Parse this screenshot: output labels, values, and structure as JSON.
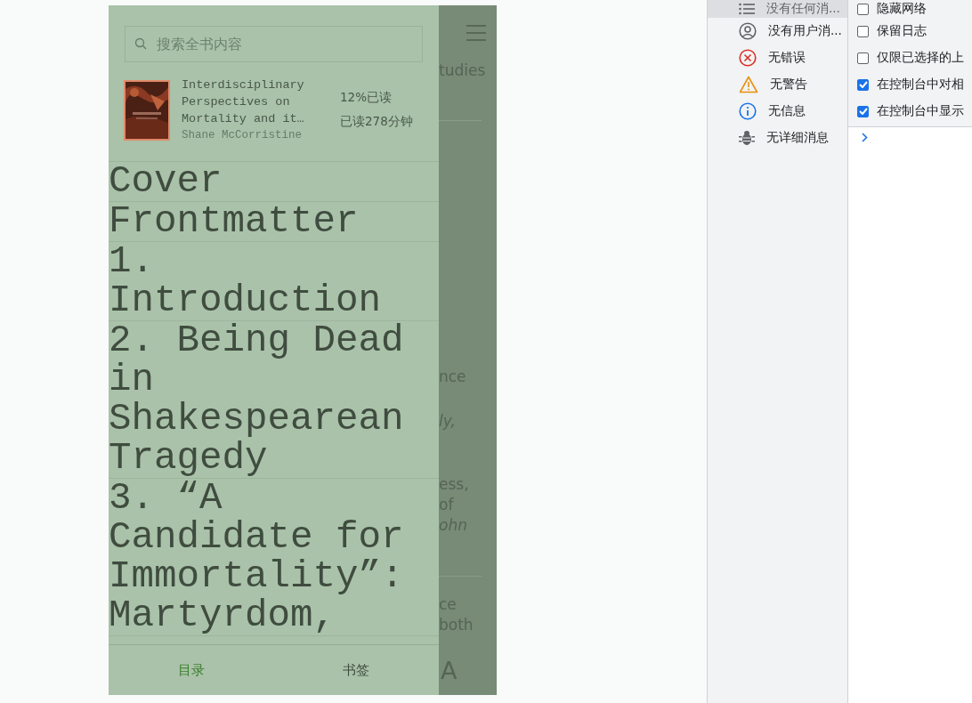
{
  "reader": {
    "fragments": [
      {
        "kind": "text",
        "text": "tudies"
      },
      {
        "kind": "rule"
      },
      {
        "kind": "text",
        "text": "nce"
      },
      {
        "kind": "italic",
        "text": "ly,"
      },
      {
        "kind": "text",
        "text": "ess,"
      },
      {
        "kind": "text",
        "text": "of"
      },
      {
        "kind": "italic",
        "text": "ohn"
      },
      {
        "kind": "rule"
      },
      {
        "kind": "text",
        "text": "ce"
      },
      {
        "kind": "text",
        "text": "both"
      }
    ],
    "toolbar_letter": "A"
  },
  "drawer": {
    "search": {
      "placeholder": "搜索全书内容"
    },
    "book": {
      "title": "Interdisciplinary Perspectives on Mortality and it…",
      "author": "Shane McCorristine",
      "progress": "12%已读",
      "time_read": "已读278分钟"
    },
    "toc": [
      {
        "title": "Cover"
      },
      {
        "title": "Frontmatter"
      },
      {
        "title": "1. Introduction"
      },
      {
        "title": "2. Being Dead in Shakespearean Tragedy"
      },
      {
        "title": "3. “A Candidate for Immortality”: Martyrdom,"
      }
    ],
    "tabs": [
      {
        "label": "目录",
        "selected": true
      },
      {
        "label": "书签",
        "selected": false
      }
    ]
  },
  "devtools": {
    "sidebar": [
      {
        "kind": "list",
        "label": "没有任何消...",
        "selected": true
      },
      {
        "kind": "user",
        "label": "没有用户消...",
        "selected": false
      },
      {
        "kind": "error",
        "label": "无错误",
        "selected": false
      },
      {
        "kind": "warning",
        "label": "无警告",
        "selected": false
      },
      {
        "kind": "info",
        "label": "无信息",
        "selected": false
      },
      {
        "kind": "verbose",
        "label": "无详细消息",
        "selected": false
      }
    ],
    "options": [
      {
        "label": "隐藏网络",
        "checked": false
      },
      {
        "label": "保留日志",
        "checked": false
      },
      {
        "label": "仅限已选择的上",
        "checked": false
      },
      {
        "label": "在控制台中对相",
        "checked": true
      },
      {
        "label": "在控制台中显示",
        "checked": true
      }
    ]
  }
}
